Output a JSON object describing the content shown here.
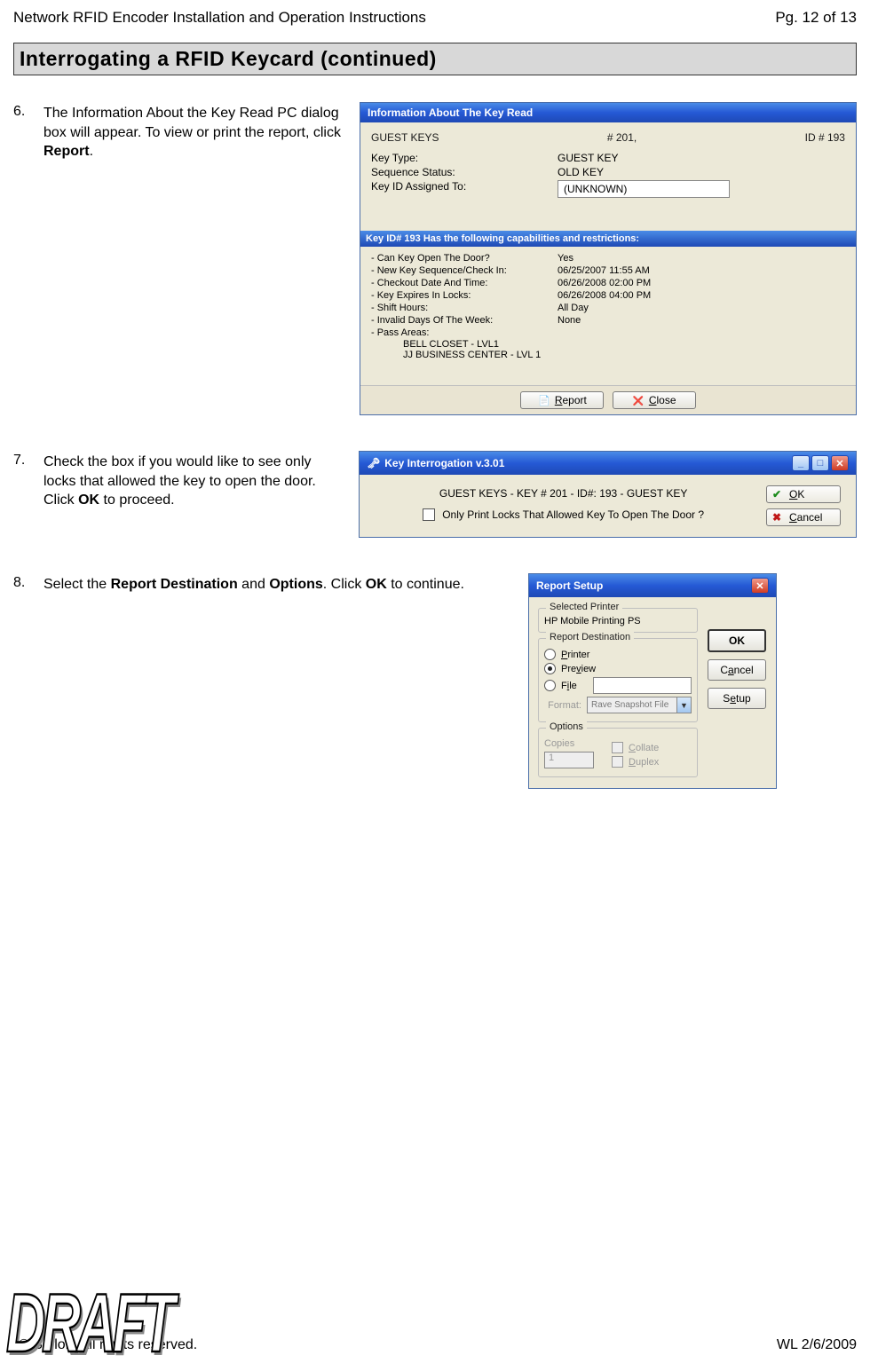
{
  "header": {
    "doc_title": "Network RFID Encoder Installation and Operation Instructions",
    "page_indicator": "Pg. 12 of 13"
  },
  "section_heading": "Interrogating a RFID Keycard (continued)",
  "steps": {
    "s6": {
      "num": "6.",
      "text_a": "The Information About the Key Read PC dialog box will appear. To view or print the report, click ",
      "text_b": "Report",
      "text_c": "."
    },
    "s7": {
      "num": "7.",
      "text_a": "Check the box if you would like to see only locks that allowed the key to open the door. Click ",
      "text_b": "OK",
      "text_c": " to proceed."
    },
    "s8": {
      "num": "8.",
      "text_a": "Select the ",
      "text_b": "Report Destination",
      "text_c": " and ",
      "text_d": "Options",
      "text_e": ". Click ",
      "text_f": "OK",
      "text_g": " to continue."
    }
  },
  "dialog1": {
    "title": "Information About The Key Read",
    "guest_keys": "GUEST KEYS",
    "room_no": "# 201,",
    "id_no": "ID # 193",
    "rows": {
      "key_type_label": "Key Type:",
      "key_type_value": "GUEST KEY",
      "seq_label": "Sequence Status:",
      "seq_value": "OLD KEY",
      "assigned_label": "Key ID Assigned To:",
      "assigned_value": "(UNKNOWN)"
    },
    "cap_header": "Key ID# 193 Has the following capabilities and restrictions:",
    "caps": [
      {
        "k": "- Can Key Open The Door?",
        "v": "Yes"
      },
      {
        "k": "- New Key Sequence/Check In:",
        "v": "06/25/2007 11:55 AM"
      },
      {
        "k": "- Checkout Date And Time:",
        "v": "06/26/2008 02:00 PM"
      },
      {
        "k": "- Key Expires In Locks:",
        "v": "06/26/2008 04:00 PM"
      },
      {
        "k": "- Shift Hours:",
        "v": "All Day"
      },
      {
        "k": "- Invalid Days Of The Week:",
        "v": "None"
      },
      {
        "k": "- Pass Areas:",
        "v": ""
      }
    ],
    "sub1": "BELL CLOSET - LVL1",
    "sub2": "JJ BUSINESS CENTER - LVL 1",
    "btn_report": "Report",
    "btn_close": "Close"
  },
  "dialog2": {
    "title": "Key Interrogation v.3.01",
    "msg1": "GUEST KEYS  -  KEY # 201  -  ID#: 193 - GUEST KEY",
    "msg2": "Only Print Locks That Allowed Key To Open The Door ?",
    "btn_ok": "OK",
    "btn_cancel": "Cancel"
  },
  "dialog3": {
    "title": "Report Setup",
    "grp_printer": "Selected Printer",
    "printer_name": "HP Mobile Printing PS",
    "grp_dest": "Report Destination",
    "opt_printer": "Printer",
    "opt_preview": "Preview",
    "opt_file": "File",
    "format_label": "Format:",
    "format_value": "Rave Snapshot File",
    "grp_options": "Options",
    "copies_label": "Copies",
    "copies_value": "1",
    "collate": "Collate",
    "duplex": "Duplex",
    "btn_ok": "OK",
    "btn_cancel": "Cancel",
    "btn_setup": "Setup"
  },
  "footer": {
    "left": "© Saflok. All rights reserved.",
    "right": "WL 2/6/2009",
    "draft": "DRAFT"
  }
}
